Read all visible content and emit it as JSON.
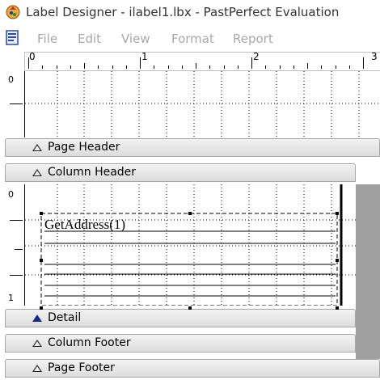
{
  "window": {
    "title": "Label Designer - ilabel1.lbx - PastPerfect Evaluation"
  },
  "menu": {
    "items": [
      "File",
      "Edit",
      "View",
      "Format",
      "Report"
    ]
  },
  "ruler": {
    "labels": [
      "0",
      "1",
      "2",
      "3"
    ]
  },
  "vertical_ruler": {
    "top_label": "0",
    "detail_labels": [
      "0",
      "1"
    ]
  },
  "bands": {
    "page_header": "Page Header",
    "column_header": "Column Header",
    "detail": "Detail",
    "column_footer": "Column Footer",
    "page_footer": "Page Footer"
  },
  "detail_field": {
    "expression": "GetAddress(1)"
  },
  "icons": {
    "app": "label-designer-app-icon",
    "menu": "document-menu-icon"
  }
}
